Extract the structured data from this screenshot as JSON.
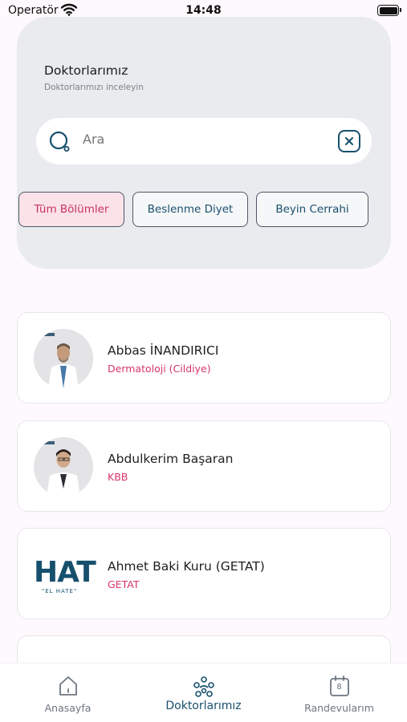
{
  "status_bar": {
    "carrier": "Operatör",
    "time": "14:48"
  },
  "header": {
    "title": "Doktorlarımız",
    "subtitle": "Doktorlarımızı inceleyin"
  },
  "search": {
    "placeholder": "Ara"
  },
  "filters": [
    {
      "label": "Tüm Bölümler",
      "active": true
    },
    {
      "label": "Beslenme Diyet",
      "active": false
    },
    {
      "label": "Beyin Cerrahi",
      "active": false
    }
  ],
  "doctors": [
    {
      "name": "Abbas İNANDIRICI",
      "department": "Dermatoloji (Cildiye)"
    },
    {
      "name": "Abdulkerim Başaran",
      "department": "KBB"
    },
    {
      "name": "Ahmet Baki Kuru (GETAT)",
      "department": "GETAT",
      "logo_text": "HAT",
      "logo_sub": "\"EL HATE\""
    }
  ],
  "nav": [
    {
      "label": "Anasayfa",
      "icon": "home-icon",
      "active": false
    },
    {
      "label": "Doktorlarımız",
      "icon": "doctors-icon",
      "active": true
    },
    {
      "label": "Randevularım",
      "icon": "calendar-icon",
      "active": false,
      "badge": "8"
    }
  ],
  "colors": {
    "accent": "#17506d",
    "pink": "#d6356a",
    "chip_active_bg": "#fbe2e8"
  }
}
